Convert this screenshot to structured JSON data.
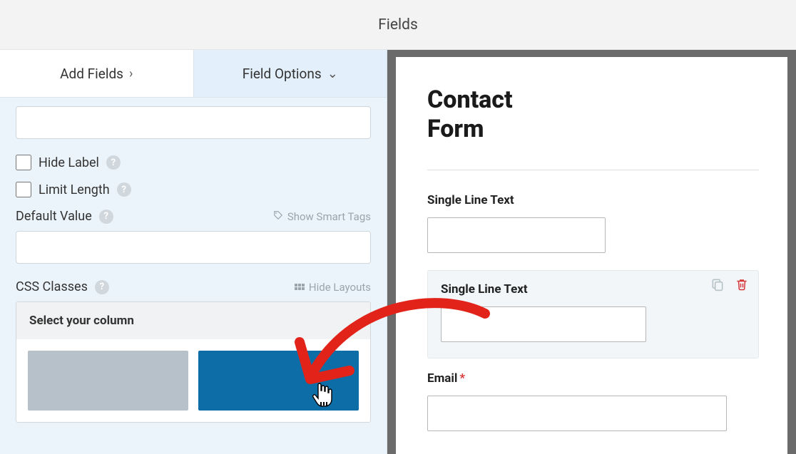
{
  "topbar": {
    "title": "Fields"
  },
  "tabs": {
    "add": "Add Fields",
    "options": "Field Options"
  },
  "options_panel": {
    "hide_label": "Hide Label",
    "limit_length": "Limit Length",
    "default_value": "Default Value",
    "show_smart_tags": "Show Smart Tags",
    "css_classes": "CSS Classes",
    "hide_layouts": "Hide Layouts",
    "select_column": "Select your column"
  },
  "preview": {
    "form_title": "Contact Form",
    "field1_label": "Single Line Text",
    "field2_label": "Single Line Text",
    "field3_label": "Email"
  }
}
